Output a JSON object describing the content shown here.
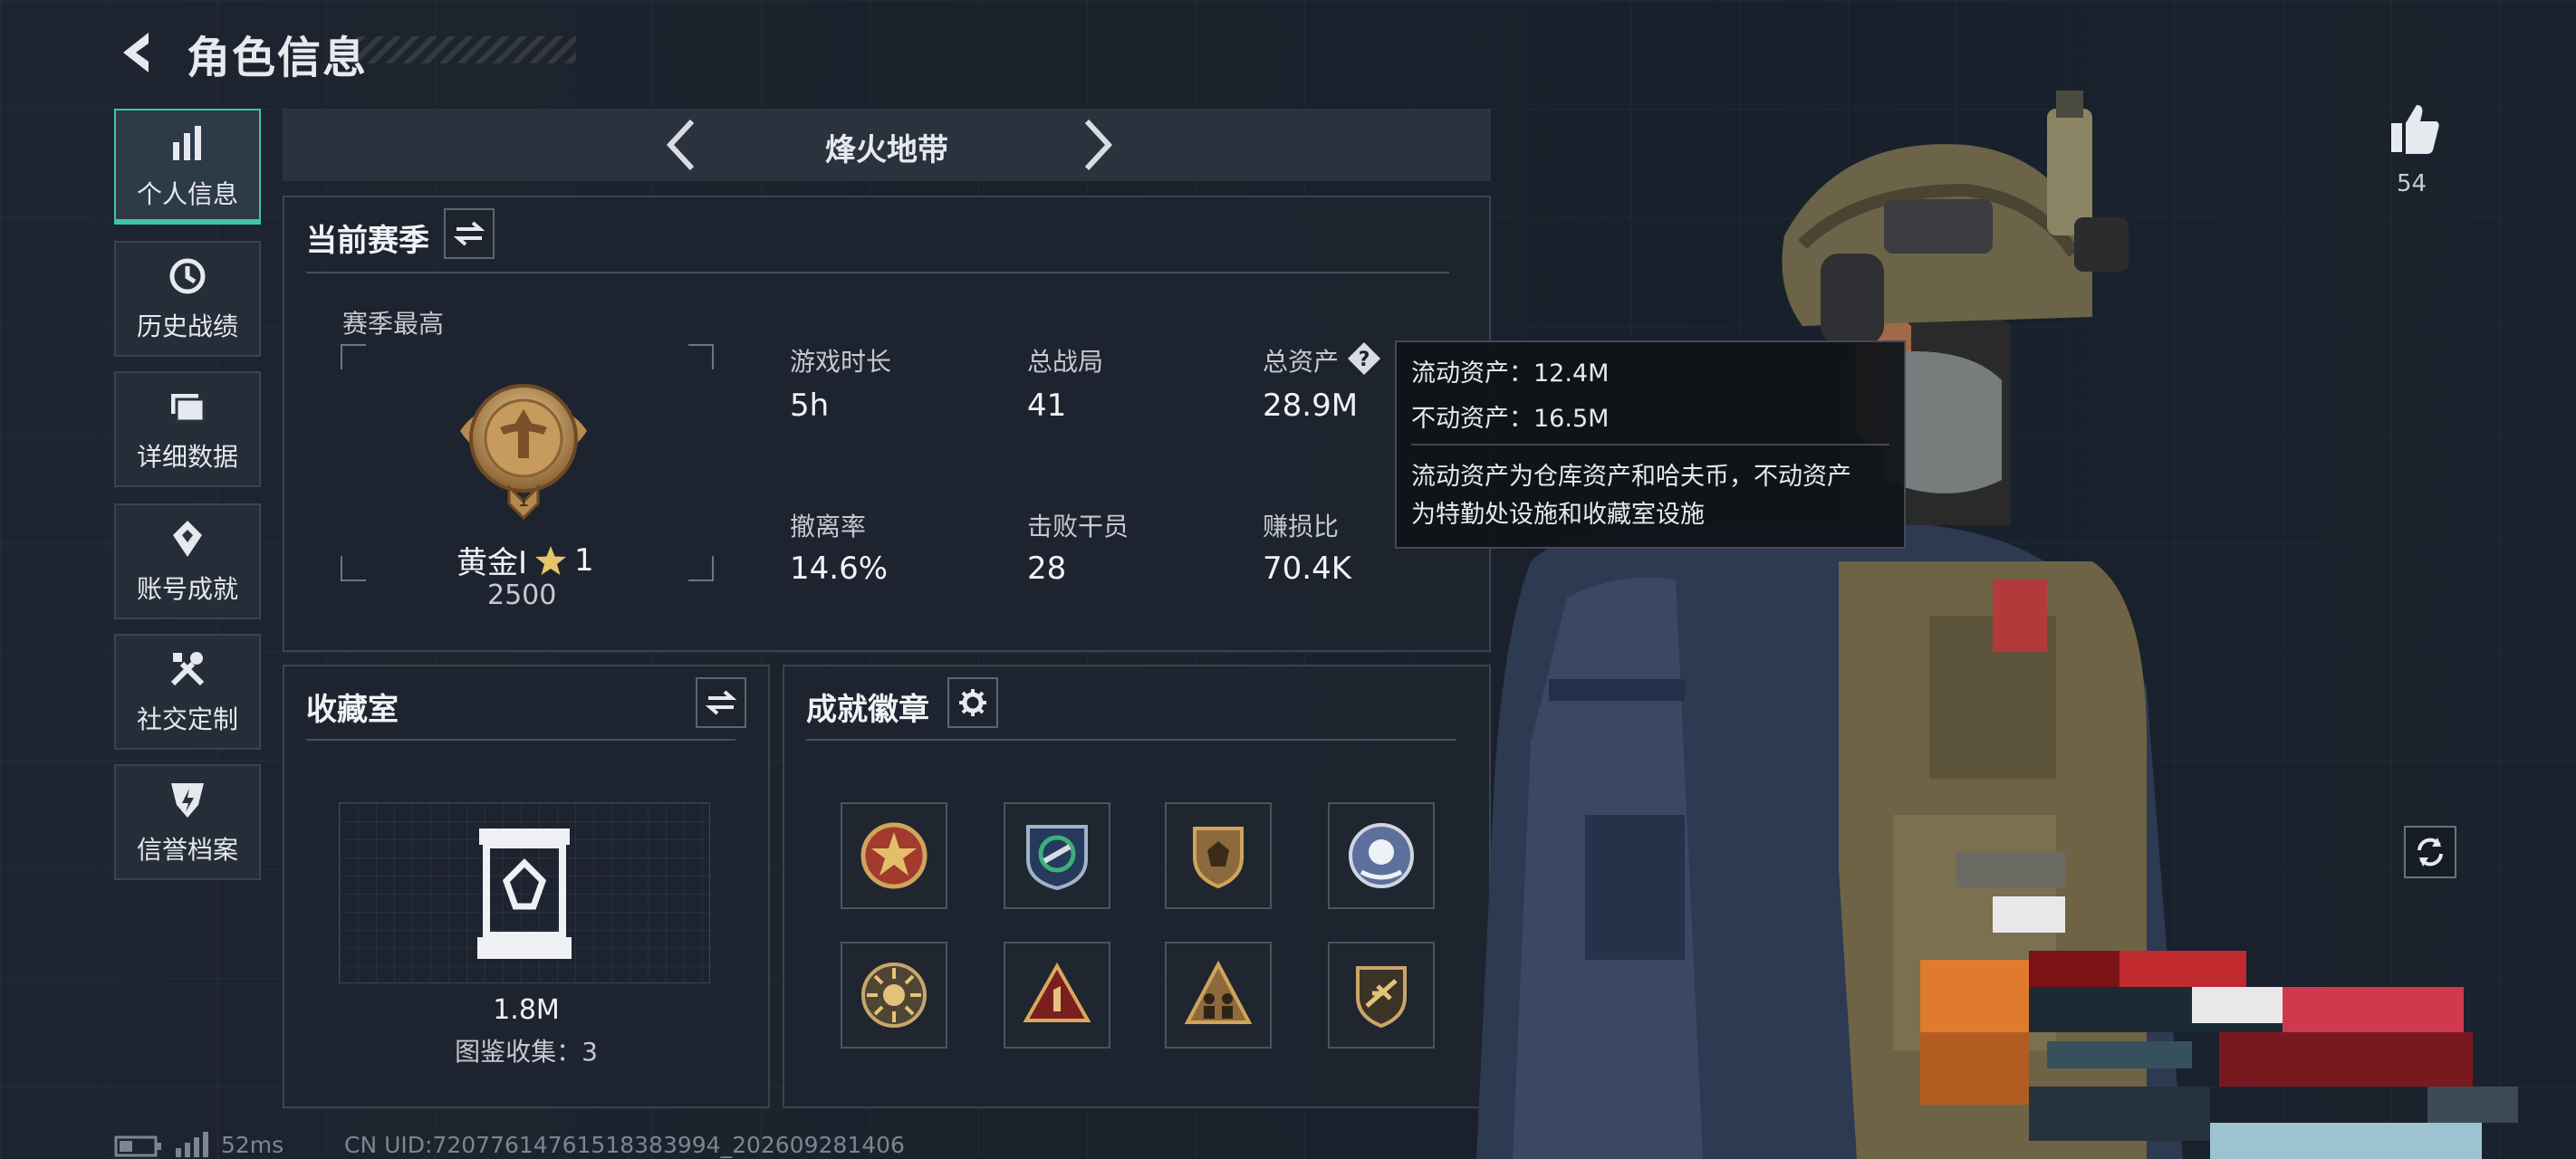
{
  "header": {
    "title": "角色信息"
  },
  "sidebar": {
    "items": [
      {
        "label": "个人信息",
        "icon": "bar-chart-icon",
        "active": true
      },
      {
        "label": "历史战绩",
        "icon": "history-icon",
        "active": false
      },
      {
        "label": "详细数据",
        "icon": "folder-icon",
        "active": false
      },
      {
        "label": "账号成就",
        "icon": "achievement-icon",
        "active": false
      },
      {
        "label": "社交定制",
        "icon": "tools-icon",
        "active": false
      },
      {
        "label": "信誉档案",
        "icon": "shield-icon",
        "active": false
      }
    ]
  },
  "mode_tab": {
    "label": "烽火地带"
  },
  "season": {
    "title": "当前赛季",
    "best_label": "赛季最高",
    "rank_name": "黄金Ⅰ",
    "rank_stars": "1",
    "rank_points": "2500",
    "medal_number": "1",
    "stats": [
      {
        "label": "游戏时长",
        "value": "5h"
      },
      {
        "label": "总战局",
        "value": "41"
      },
      {
        "label": "总资产",
        "value": "28.9M",
        "help": "?"
      },
      {
        "label": "撤离率",
        "value": "14.6%"
      },
      {
        "label": "击败干员",
        "value": "28"
      },
      {
        "label": "赚损比",
        "value": "70.4K"
      }
    ]
  },
  "tooltip": {
    "liquid": "流动资产：12.4M",
    "fixed": "不动资产：16.5M",
    "desc1": "流动资产为仓库资产和哈夫币，不动资产",
    "desc2": "为特勤处设施和收藏室设施"
  },
  "collection": {
    "title": "收藏室",
    "value": "1.8M",
    "count_text": "图鉴收集：3"
  },
  "badges": {
    "title": "成就徽章",
    "items": [
      "star-emblem-badge",
      "dove-emblem-badge",
      "shield-emblem-badge",
      "flower-emblem-badge",
      "sun-emblem-badge",
      "number-one-badge",
      "team-badge",
      "aircraft-badge"
    ]
  },
  "social": {
    "likes": "54"
  },
  "footer": {
    "ping": "52ms",
    "uid": "CN UID:72077614761518383994_202609281406"
  },
  "colors": {
    "accent": "#3fc6a4",
    "gold": "#c9a36b"
  }
}
